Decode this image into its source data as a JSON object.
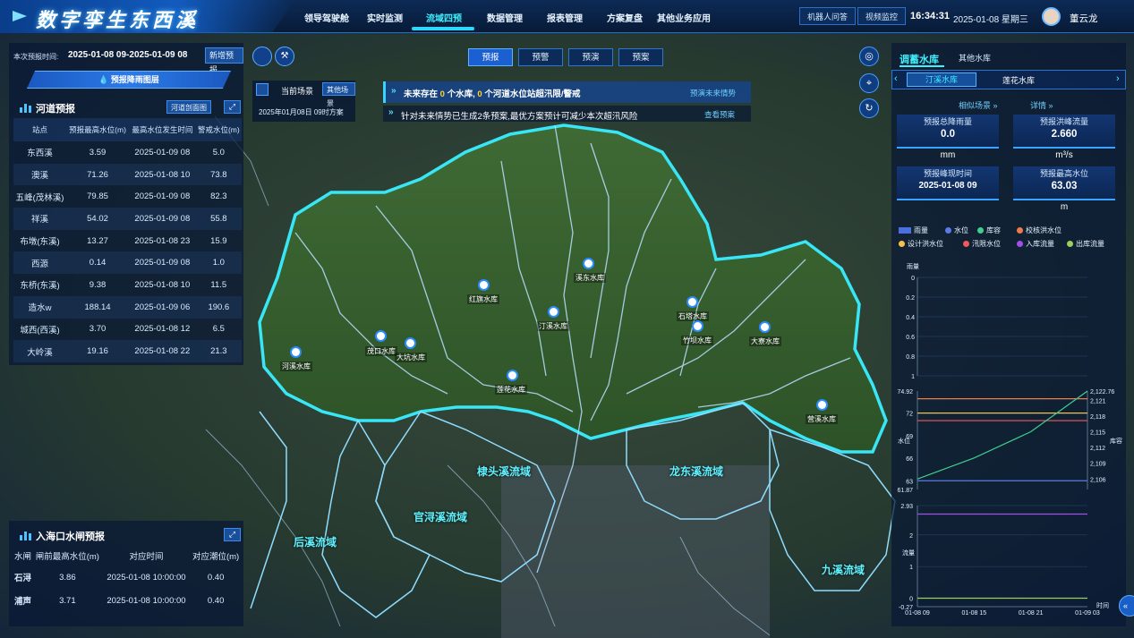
{
  "app": {
    "title": "数字孪生东西溪"
  },
  "nav": {
    "items": [
      "领导驾驶舱",
      "实时监测",
      "流域四预",
      "数据管理",
      "报表管理",
      "方案复盘",
      "其他业务应用"
    ],
    "active_index": 2
  },
  "header_right": {
    "robot_btn": "机器人问答",
    "video_btn": "视频监控",
    "time": "16:34:31",
    "date": "2025-01-08 星期三",
    "user": "董云龙"
  },
  "forecast_time": {
    "label": "本次预报时间:",
    "value": "2025-01-08 09-2025-01-09 08",
    "new_btn": "新增预报",
    "rain_layer_btn": "预报降雨图层"
  },
  "river_forecast": {
    "title": "河道预报",
    "profile_btn": "河道剖面图",
    "columns": [
      "站点",
      "预报最高水位(m)",
      "最高水位发生时间",
      "警戒水位(m)"
    ],
    "rows": [
      [
        "东西溪",
        "3.59",
        "2025-01-09 08",
        "5.0"
      ],
      [
        "澳溪",
        "71.26",
        "2025-01-08 10",
        "73.8"
      ],
      [
        "五峰(茂林溪)",
        "79.85",
        "2025-01-09 08",
        "82.3"
      ],
      [
        "祥溪",
        "54.02",
        "2025-01-09 08",
        "55.8"
      ],
      [
        "布墩(东溪)",
        "13.27",
        "2025-01-08 23",
        "15.9"
      ],
      [
        "西源",
        "0.14",
        "2025-01-09 08",
        "1.0"
      ],
      [
        "东桥(东溪)",
        "9.38",
        "2025-01-08 10",
        "11.5"
      ],
      [
        "造水w",
        "188.14",
        "2025-01-09 06",
        "190.6"
      ],
      [
        "城西(西溪)",
        "3.70",
        "2025-01-08 12",
        "6.5"
      ],
      [
        "大岭溪",
        "19.16",
        "2025-01-08 22",
        "21.3"
      ]
    ]
  },
  "estuary_gate": {
    "title": "入海口水闸预报",
    "columns": [
      "水闸",
      "闸前最高水位(m)",
      "对应时间",
      "对应潮位(m)"
    ],
    "rows": [
      [
        "石浔",
        "3.86",
        "2025-01-08 10:00:00",
        "0.40"
      ],
      [
        "浦声",
        "3.71",
        "2025-01-08 10:00:00",
        "0.40"
      ]
    ]
  },
  "mode_tabs": {
    "items": [
      "预报",
      "预警",
      "预演",
      "预案"
    ],
    "active_index": 0
  },
  "scene": {
    "current_btn": "当前场景",
    "other_btn": "其他场景",
    "plan": "2025年01月08日 09时方案"
  },
  "alerts": {
    "line1_pre": "未来存在",
    "line1_n1": "0",
    "line1_mid": "个水库,",
    "line1_n2": "0",
    "line1_post": "个河道水位站超汛限/警戒",
    "line1_link": "预演未来情势",
    "line2": "针对未来情势已生成2条预案,最优方案预计可减少本次超汛风险",
    "line2_link": "查看预案"
  },
  "map": {
    "reservoirs": [
      "溪东水库",
      "红旗水库",
      "汀溪水库",
      "石塔水库",
      "竹坝水库",
      "大寮水库",
      "茂口水库",
      "大坑水库",
      "河溪水库",
      "莲花水库",
      "营溪水库"
    ],
    "basins": [
      "棣头溪流域",
      "龙东溪流域",
      "官浔溪流域",
      "后溪流域",
      "九溪流域"
    ]
  },
  "reservoir_panel": {
    "tab_active": "调蓄水库",
    "tab_other": "其他水库",
    "subtabs": [
      "汀溪水库",
      "莲花水库"
    ],
    "links": [
      "相似场景",
      "详情"
    ],
    "cards": [
      {
        "label": "预报总降雨量",
        "value": "0.0",
        "unit": "mm"
      },
      {
        "label": "预报洪峰流量",
        "value": "2.660",
        "unit": "m³/s"
      },
      {
        "label": "预报峰现时间",
        "value": "2025-01-08 09",
        "unit": ""
      },
      {
        "label": "预报最高水位",
        "value": "63.03",
        "unit": "m"
      }
    ],
    "legend": [
      {
        "name": "雨量",
        "color": "#4b6fe0"
      },
      {
        "name": "水位",
        "color": "#5a7be6"
      },
      {
        "name": "库容",
        "color": "#3fcf8e"
      },
      {
        "name": "校核洪水位",
        "color": "#f07b4a"
      },
      {
        "name": "设计洪水位",
        "color": "#f2c14e"
      },
      {
        "name": "汛限水位",
        "color": "#f05a5a"
      },
      {
        "name": "入库流量",
        "color": "#a24fe8"
      },
      {
        "name": "出库流量",
        "color": "#9ccf5a"
      }
    ]
  },
  "chart_data": {
    "type": "line",
    "x": [
      "01-08 09",
      "01-08 15",
      "01-08 21",
      "01-09 03"
    ],
    "panels": [
      {
        "ylabel": "雨量",
        "yticks": [
          "0",
          "0.2",
          "0.4",
          "0.6",
          "0.8",
          "1"
        ],
        "series": [
          {
            "name": "雨量",
            "values": [
              0,
              0,
              0,
              0
            ]
          }
        ]
      },
      {
        "ylabel": "水位",
        "y2label": "库容",
        "yticks": [
          "74.92",
          "72",
          "69",
          "66",
          "63",
          "61.87"
        ],
        "y2ticks": [
          "2,122.76",
          "2,121",
          "2,118",
          "2,115",
          "2,112",
          "2,109",
          "2,106"
        ],
        "series": [
          {
            "name": "校核洪水位",
            "values": [
              73.9,
              73.9,
              73.9,
              73.9
            ]
          },
          {
            "name": "设计洪水位",
            "values": [
              72.0,
              72.0,
              72.0,
              72.0
            ]
          },
          {
            "name": "汛限水位",
            "values": [
              71.0,
              71.0,
              71.0,
              71.0
            ]
          },
          {
            "name": "水位",
            "values": [
              63.03,
              63.03,
              63.03,
              63.03
            ]
          },
          {
            "name": "库容",
            "values": [
              2106,
              2110,
              2115,
              2122.76
            ]
          }
        ]
      },
      {
        "ylabel": "流量",
        "yticks": [
          "2.93",
          "2",
          "1",
          "0",
          "-0.27"
        ],
        "x_axis_label": "时间",
        "series": [
          {
            "name": "入库流量",
            "values": [
              2.66,
              2.66,
              2.66,
              2.66
            ]
          },
          {
            "name": "出库流量",
            "values": [
              0,
              0,
              0,
              0
            ]
          }
        ]
      }
    ]
  }
}
